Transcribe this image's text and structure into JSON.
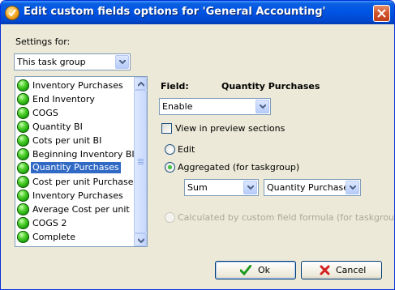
{
  "window": {
    "title": "Edit custom fields options for  'General Accounting'"
  },
  "settings": {
    "label": "Settings for:",
    "selected": "This task group"
  },
  "list": {
    "selected_index": 6,
    "items": [
      "Inventory Purchases",
      "End Inventory",
      "COGS",
      "Quantity BI",
      "Cots per unit BI",
      "Beginning Inventory BI",
      "Quantity Purchases",
      "Cost per unit Purchases",
      "Inventory Purchases",
      "Average Cost per unit",
      "COGS 2",
      "Complete"
    ]
  },
  "field": {
    "label": "Field:",
    "name": "Quantity Purchases",
    "mode": "Enable",
    "view_in_preview_label": "View in preview sections",
    "view_in_preview_checked": false,
    "radio_edit": "Edit",
    "radio_aggregated": "Aggregated (for taskgroup)",
    "aggregate_function": "Sum",
    "aggregate_field": "Quantity Purchases",
    "radio_calculated": "Calculated by custom field formula (for taskgroup)",
    "selected_option": "aggregated"
  },
  "buttons": {
    "ok": "Ok",
    "cancel": "Cancel"
  },
  "colors": {
    "title_bar": "#0055e5",
    "dialog_bg": "#ece9d8",
    "selection": "#316ac5",
    "status_dot": "#21a121"
  }
}
